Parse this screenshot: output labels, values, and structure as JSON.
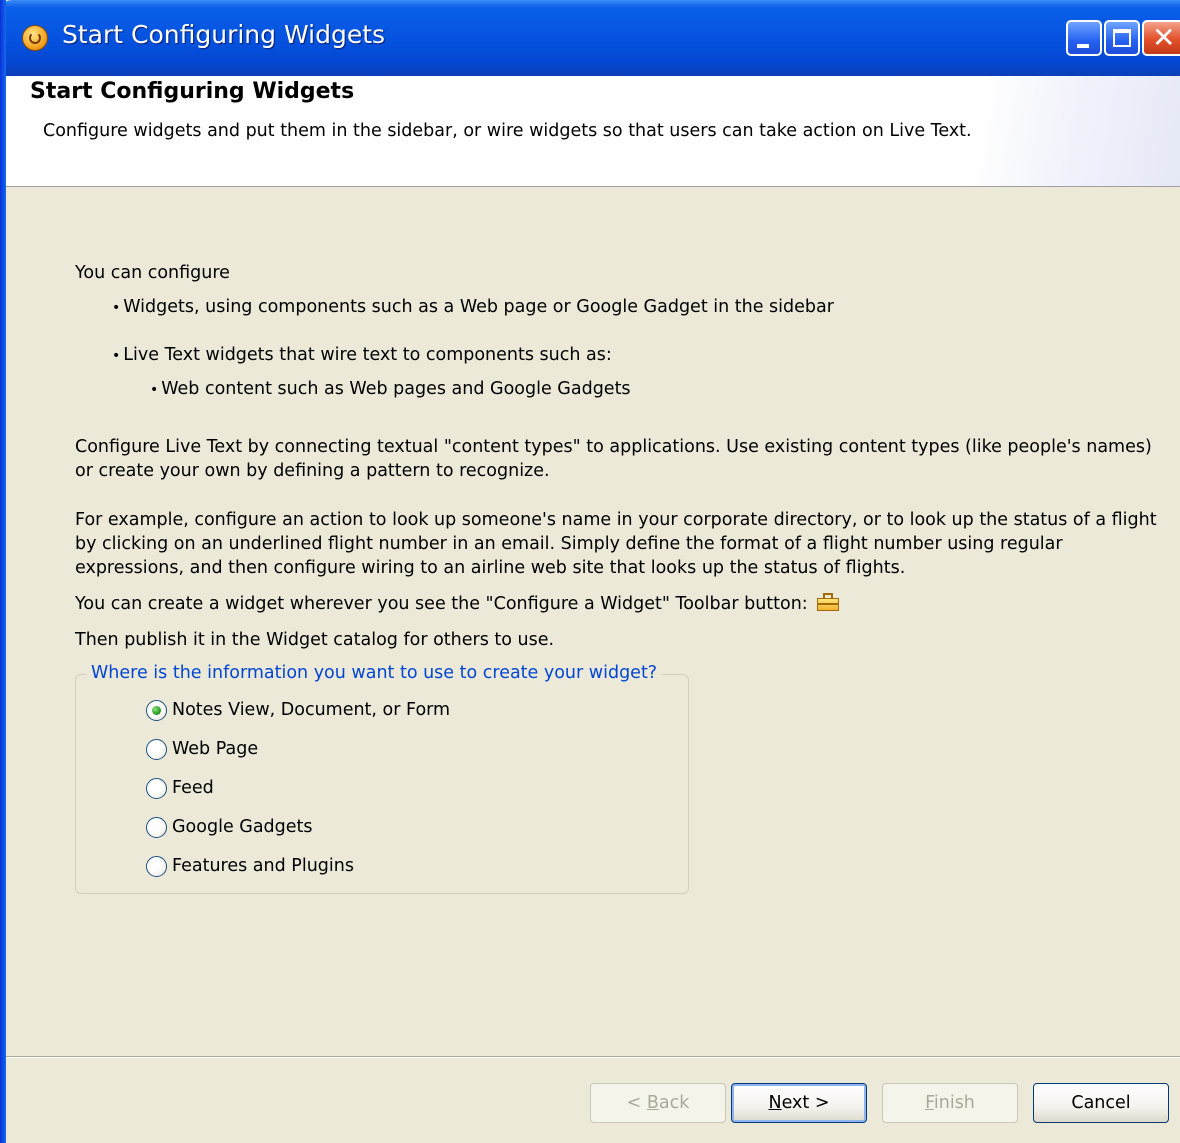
{
  "window": {
    "title": "Start Configuring Widgets"
  },
  "header": {
    "title": "Start Configuring Widgets",
    "description": "Configure widgets and put them in the sidebar, or wire widgets so that users can take action on Live Text."
  },
  "body": {
    "intro": "You can configure",
    "bullets": [
      "Widgets, using components such as a Web page or Google Gadget in the sidebar",
      "Live Text widgets that wire text to components such as:"
    ],
    "sub_bullets": [
      "Web content such as Web pages and Google Gadgets"
    ],
    "para_live_text": "Configure Live Text by connecting textual \"content types\" to applications. Use existing content types (like people's names) or create your own by defining a pattern to recognize.",
    "para_example": "For example, configure an action to look up someone's name in your corporate directory, or to look up the status of a flight by clicking on an underlined flight number in an email.  Simply define the format of a flight number using regular expressions, and then configure wiring to an airline web site that looks up the status of flights.",
    "toolbar_line": "You can create a widget wherever you see the \"Configure a Widget\" Toolbar button:",
    "publish_line": "Then publish it in the Widget catalog for others to use."
  },
  "source_group": {
    "legend": "Where is the information you want to use to create your widget?",
    "selected_index": 0,
    "options": [
      "Notes View, Document, or Form",
      "Web Page",
      "Feed",
      "Google Gadgets",
      "Features and Plugins"
    ]
  },
  "buttons": {
    "back": {
      "label": "< Back",
      "mnemonic": "B",
      "enabled": false
    },
    "next": {
      "label": "Next >",
      "mnemonic": "N",
      "enabled": true
    },
    "finish": {
      "label": "Finish",
      "mnemonic": "F",
      "enabled": false
    },
    "cancel": {
      "label": "Cancel",
      "enabled": true
    }
  },
  "colors": {
    "titlebar": "#0553e0",
    "dialog_bg": "#ece9d8",
    "group_legend": "#0046d5",
    "selected_radio": "#2a9d22"
  },
  "icons": {
    "app": "lotus-notes-icon",
    "toolbar_button": "briefcase-icon"
  }
}
